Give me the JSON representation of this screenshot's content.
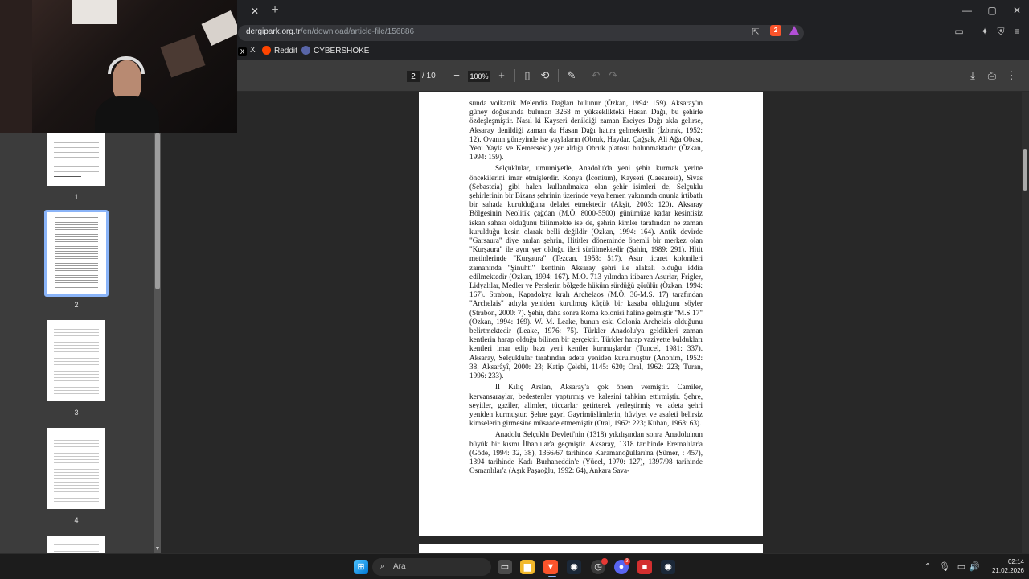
{
  "browser": {
    "tab_close": "✕",
    "new_tab": "+",
    "window_controls": {
      "minimize": "—",
      "maximize": "▢",
      "close": "✕"
    },
    "url_host": "dergipark.org.tr",
    "url_path": "/en/download/article-file/156886",
    "brave_shield_count": "2",
    "bookmarks": [
      {
        "label": "X",
        "icon": "x-icon"
      },
      {
        "label": "Reddit",
        "icon": "reddit-icon"
      },
      {
        "label": "CYBERSHOKE",
        "icon": "cybershoke-icon"
      }
    ]
  },
  "pdf_toolbar": {
    "current_page": "2",
    "total_pages": "/ 10",
    "zoom": "100%"
  },
  "sidebar": {
    "thumbnails": [
      {
        "label": "1"
      },
      {
        "label": "2"
      },
      {
        "label": "3"
      },
      {
        "label": "4"
      }
    ],
    "selected_thumbnail": "2"
  },
  "document": {
    "paragraphs": [
      "sunda volkanik Melendiz Dağları bulunur (Özkan, 1994: 159). Aksaray'ın güney doğusunda bulunan 3268 m yükseklikteki Hasan Dağı, bu şehirle özdeşleşmiştir. Nasıl ki Kayseri denildiği zaman Erciyes Dağı akla gelirse, Aksaray denildiği zaman da Hasan Dağı hatıra gelmektedir (İzbırak, 1952: 12). Ovanın güneyinde ise yaylaların (Obruk, Haydar, Çağşak, Ali Ağa Obası, Yeni Yayla ve Kemerseki) yer aldığı Obruk platosu bulunmaktadır (Özkan, 1994: 159).",
      "Selçuklular, umumiyetle, Anadolu'da yeni şehir kurmak yerine öncekilerini imar etmişlerdir. Konya (İconium), Kayseri (Caesareia), Sivas (Sebasteia) gibi halen kullanılmakta olan şehir isimleri de, Selçuklu şehirlerinin bir Bizans şehrinin üzerinde veya hemen yakınında onunla irtibatlı bir sahada kurulduğuna delalet etmektedir (Akşit, 2003: 120). Aksaray Bölgesinin Neolitik çağdan (M.Ö. 8000-5500) günümüze kadar kesintisiz iskan sahası olduğunu bilinmekte ise de, şehrin kimler tarafından ne zaman kurulduğu kesin olarak belli değildir (Özkan, 1994: 164). Antik devirde \"Garsaura\" diye anılan şehrin, Hititler döneminde önemli bir merkez olan \"Kurşaura\" ile aynı yer olduğu ileri sürülmektedir (Şahin, 1989: 291). Hitit metinlerinde \"Kurşaura\" (Tezcan, 1958: 517), Asur ticaret kolonileri zamanında \"Şinuhti\" kentinin Aksaray şehri ile alakalı olduğu iddia edilmektedir (Özkan, 1994: 167). M.Ö. 713 yılından itibaren Asurlar, Frigler, Lidyalılar, Medler ve Perslerin bölgede hüküm sürdüğü görülür (Özkan, 1994: 167). Strabon, Kapadokya kralı Archelaos (M.Ö. 36-M.S. 17) tarafından \"Archelais\" adıyla yeniden kurulmuş küçük bir kasaba olduğunu söyler (Strabon, 2000: 7). Şehir, daha sonra Roma kolonisi haline gelmiştir \"M.S 17\"(Özkan, 1994: 169). W. M. Leake, bunun eski Colonia Archelais olduğunu belirtmektedir (Leake, 1976: 75). Türkler Anadolu'ya geldikleri zaman kentlerin harap olduğu bilinen bir gerçektir. Türkler harap vaziyette buldukları kentleri imar edip bazı yeni kentler kurmuşlardır (Tuncel, 1981: 337). Aksaray, Selçuklular tarafından adeta yeniden kurulmuştur (Anonim, 1952: 38; Aksarâyî, 2000: 23; Katip Çelebi, 1145: 620; Oral, 1962: 223; Turan, 1996: 233).",
      "II Kılıç Arslan, Aksaray'a çok önem vermiştir. Camiler, kervansaraylar, bedestenler yaptırmış ve kalesini tahkim ettirmiştir. Şehre, seyitler, gaziler, alimler, tüccarlar getirterek yerleştirmiş ve adeta şehri yeniden kurmuştur. Şehre gayri Gayrimüslimlerin, hüviyet ve asaleti belirsiz kimselerin girmesine müsaade etmemiştir (Oral, 1962: 223; Kuban, 1968: 63).",
      "Anadolu Selçuklu Devleti'nin (1318) yıkılışından sonra Anadolu'nun büyük bir kısmı İlhanlılar'a geçmiştir. Aksaray, 1318 tarihinde Eretnalılar'a (Göde, 1994: 32, 38), 1366/67 tarihinde Karamanoğulları'na (Sümer, : 457), 1394 tarihinde Kadı Burhaneddin'e (Yücel, 1970: 127), 1397/98 tarihinde Osmanlılar'a (Aşık Paşaoğlu, 1992: 64), Ankara Sava-"
    ]
  },
  "taskbar": {
    "search_placeholder": "Ara",
    "time": "02:14",
    "date": "21.02.2026",
    "discord_badge": "3"
  }
}
